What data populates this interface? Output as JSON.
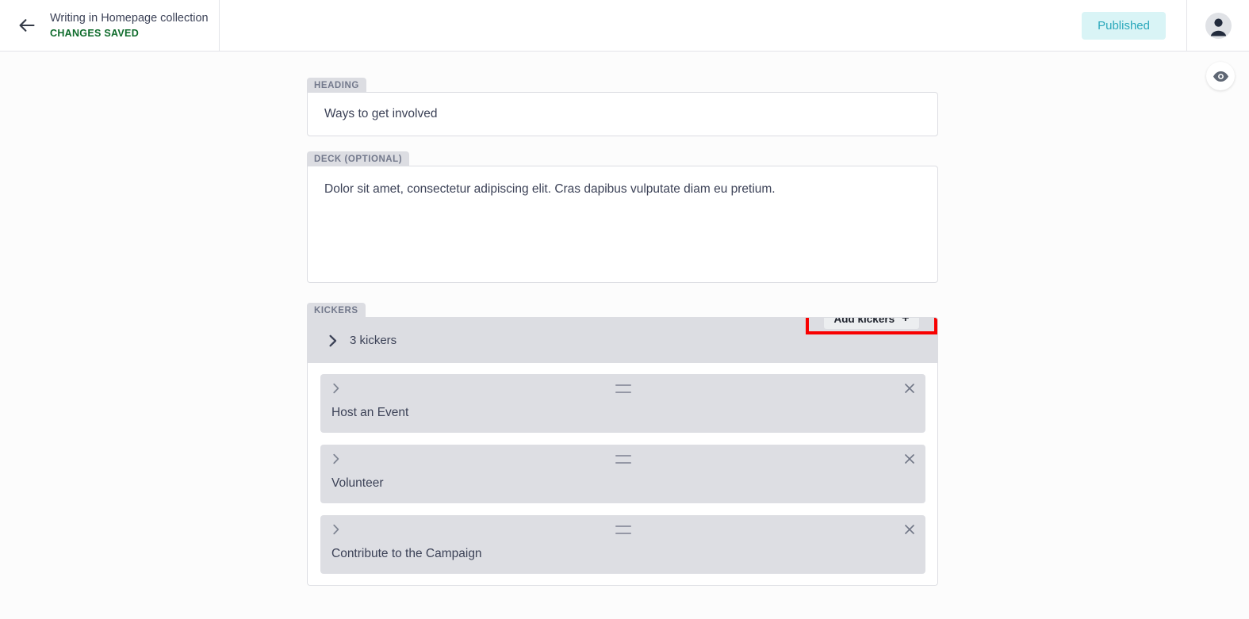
{
  "topbar": {
    "back_icon": "arrow-left-icon",
    "title": "Writing in Homepage collection",
    "status": "CHANGES SAVED",
    "status_color": "#0e6b2b",
    "published_label": "Published",
    "published_bg": "#d9f4f6",
    "published_text_color": "#2aa8bb",
    "avatar_icon": "user-avatar-icon"
  },
  "preview": {
    "icon": "eye-icon",
    "tooltip": "Preview"
  },
  "fields": {
    "heading": {
      "label": "HEADING",
      "value": "Ways to get involved"
    },
    "deck": {
      "label": "DECK (OPTIONAL)",
      "value": "Dolor sit amet, consectetur adipiscing elit. Cras dapibus vulputate diam eu pretium."
    }
  },
  "kickers": {
    "label": "KICKERS",
    "count_label": "3 kickers",
    "expand_icon": "chevron-right-icon",
    "add_button": {
      "label": "Add kickers",
      "plus": "+",
      "highlight_color": "#f80000"
    },
    "items": [
      {
        "title": "Host an Event",
        "expand_icon": "chevron-right-icon",
        "drag_icon": "drag-handle-icon",
        "close_icon": "close-icon"
      },
      {
        "title": "Volunteer",
        "expand_icon": "chevron-right-icon",
        "drag_icon": "drag-handle-icon",
        "close_icon": "close-icon"
      },
      {
        "title": "Contribute to the Campaign",
        "expand_icon": "chevron-right-icon",
        "drag_icon": "drag-handle-icon",
        "close_icon": "close-icon"
      }
    ]
  }
}
